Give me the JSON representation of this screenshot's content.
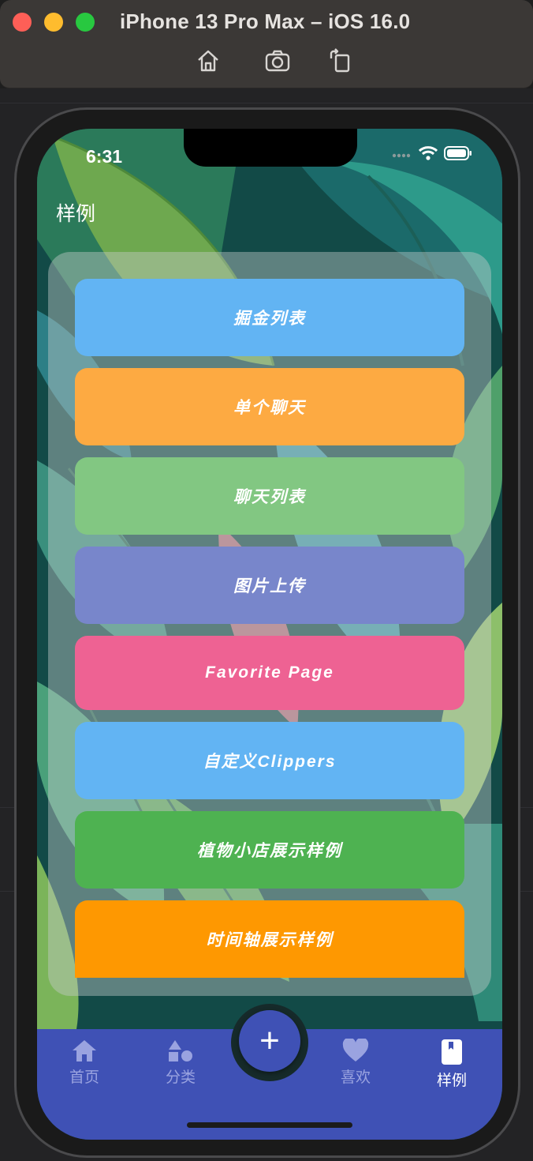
{
  "window": {
    "title": "iPhone 13 Pro Max – iOS 16.0",
    "tools": [
      "home-icon",
      "screenshot-icon",
      "rotate-icon"
    ]
  },
  "status_bar": {
    "time": "6:31"
  },
  "app": {
    "page_title": "样例",
    "menu": [
      {
        "label": "掘金列表",
        "color": "#62b4f3"
      },
      {
        "label": "单个聊天",
        "color": "#fdaa42"
      },
      {
        "label": "聊天列表",
        "color": "#82c782"
      },
      {
        "label": "图片上传",
        "color": "#7886cb"
      },
      {
        "label": "Favorite Page",
        "color": "#ee6293"
      },
      {
        "label": "自定义Clippers",
        "color": "#62b4f3"
      },
      {
        "label": "植物小店展示样例",
        "color": "#4eb251"
      },
      {
        "label": "时间轴展示样例",
        "color": "#fe9801"
      }
    ],
    "fab_label": "+",
    "tabs": [
      {
        "label": "首页",
        "icon": "home-icon",
        "active": false
      },
      {
        "label": "分类",
        "icon": "shapes-icon",
        "active": false
      },
      {
        "label": "喜欢",
        "icon": "heart-icon",
        "active": false
      },
      {
        "label": "样例",
        "icon": "book-icon",
        "active": true
      }
    ]
  },
  "colors": {
    "tabbar": "#3f51b5",
    "tab_inactive": "#9aa3e0",
    "tab_active": "#ffffff"
  }
}
